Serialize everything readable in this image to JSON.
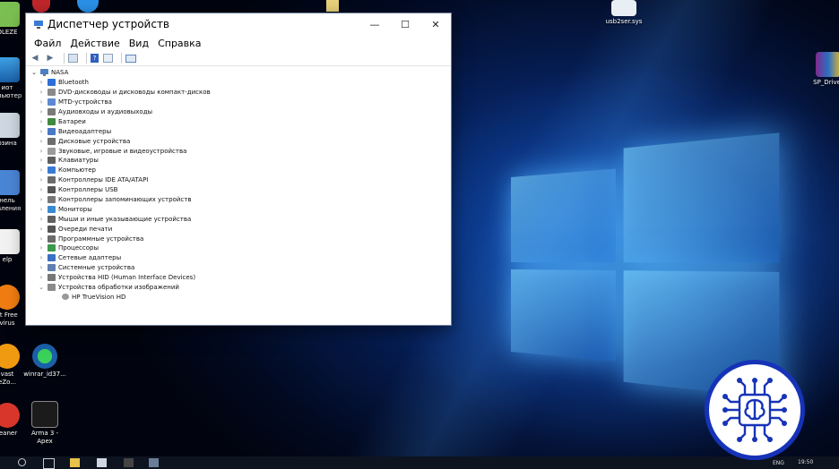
{
  "window": {
    "title": "Диспетчер устройств",
    "controls": {
      "minimize": "—",
      "maximize": "☐",
      "close": "✕"
    }
  },
  "menu": [
    "Файл",
    "Действие",
    "Вид",
    "Справка"
  ],
  "tree": {
    "root": "NASA",
    "items": [
      "Bluetooth",
      "DVD-дисководы и дисководы компакт-дисков",
      "MTD-устройства",
      "Аудиовходы и аудиовыходы",
      "Батареи",
      "Видеоадаптеры",
      "Дисковые устройства",
      "Звуковые, игровые и видеоустройства",
      "Клавиатуры",
      "Компьютер",
      "Контроллеры IDE ATA/ATAPI",
      "Контроллеры USB",
      "Контроллеры запоминающих устройств",
      "Мониторы",
      "Мыши и иные указывающие устройства",
      "Очереди печати",
      "Программные устройства",
      "Процессоры",
      "Сетевые адаптеры",
      "Системные устройства",
      "Устройства HID (Human Interface Devices)",
      "Устройства обработки изображений"
    ],
    "child": "HP TrueVision HD"
  },
  "desktop_icons": {
    "top_left": "OLEZE",
    "left1": "иот\nмпьютер",
    "left2": "рзина",
    "left3": "нель\nавления",
    "left4": "elp",
    "left5": "st Free\nvirus",
    "left6": "vast\neZo...",
    "winrar": "winrar_id37...",
    "left7": "leaner",
    "arma": "Arma 3 -\nApex",
    "usb": "usb2ser.sys",
    "sp": "SP_Driver"
  },
  "taskbar": {
    "lang": "ENG",
    "time": "19:50"
  },
  "colors": {
    "accent": "#1633b8"
  }
}
